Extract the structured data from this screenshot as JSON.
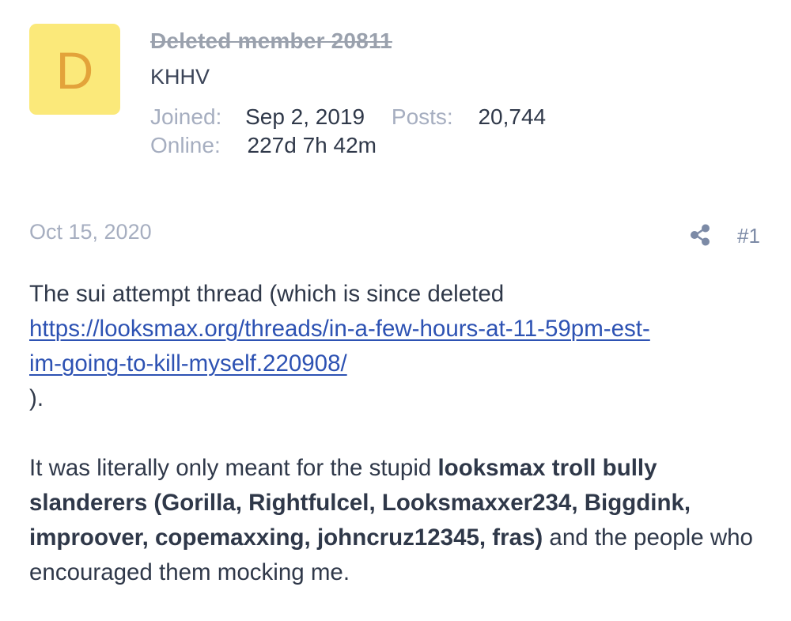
{
  "member": {
    "avatar_letter": "D",
    "avatar_color": "#fbe97a",
    "avatar_letter_color": "#e3a33a",
    "name": "Deleted member 20811",
    "title": "KHHV",
    "joined_label": "Joined:",
    "joined_value": "Sep 2, 2019",
    "posts_label": "Posts:",
    "posts_value": "20,744",
    "online_label": "Online:",
    "online_value": "227d 7h 42m"
  },
  "post": {
    "date": "Oct 15, 2020",
    "share_icon": "share-icon",
    "number": "#1",
    "para1_text": "The sui attempt thread (which is since deleted",
    "link_line1": "https://looksmax.org/threads/in-a-few-hours-at-11-59pm-est-",
    "link_line2": "im-going-to-kill-myself.220908/",
    "para1_close": ").",
    "para2_start": "It was literally only meant for the stupid ",
    "para2_bold": "looksmax troll bully slanderers (Gorilla, Rightfulcel, Looksmaxxer234, Biggdink, improover, copemaxxing, johncruz12345, fras)",
    "para2_end": " and the people who encouraged them mocking me."
  },
  "colors": {
    "link": "#2d52b3",
    "muted": "#a6aec0",
    "text": "#2f3849"
  }
}
